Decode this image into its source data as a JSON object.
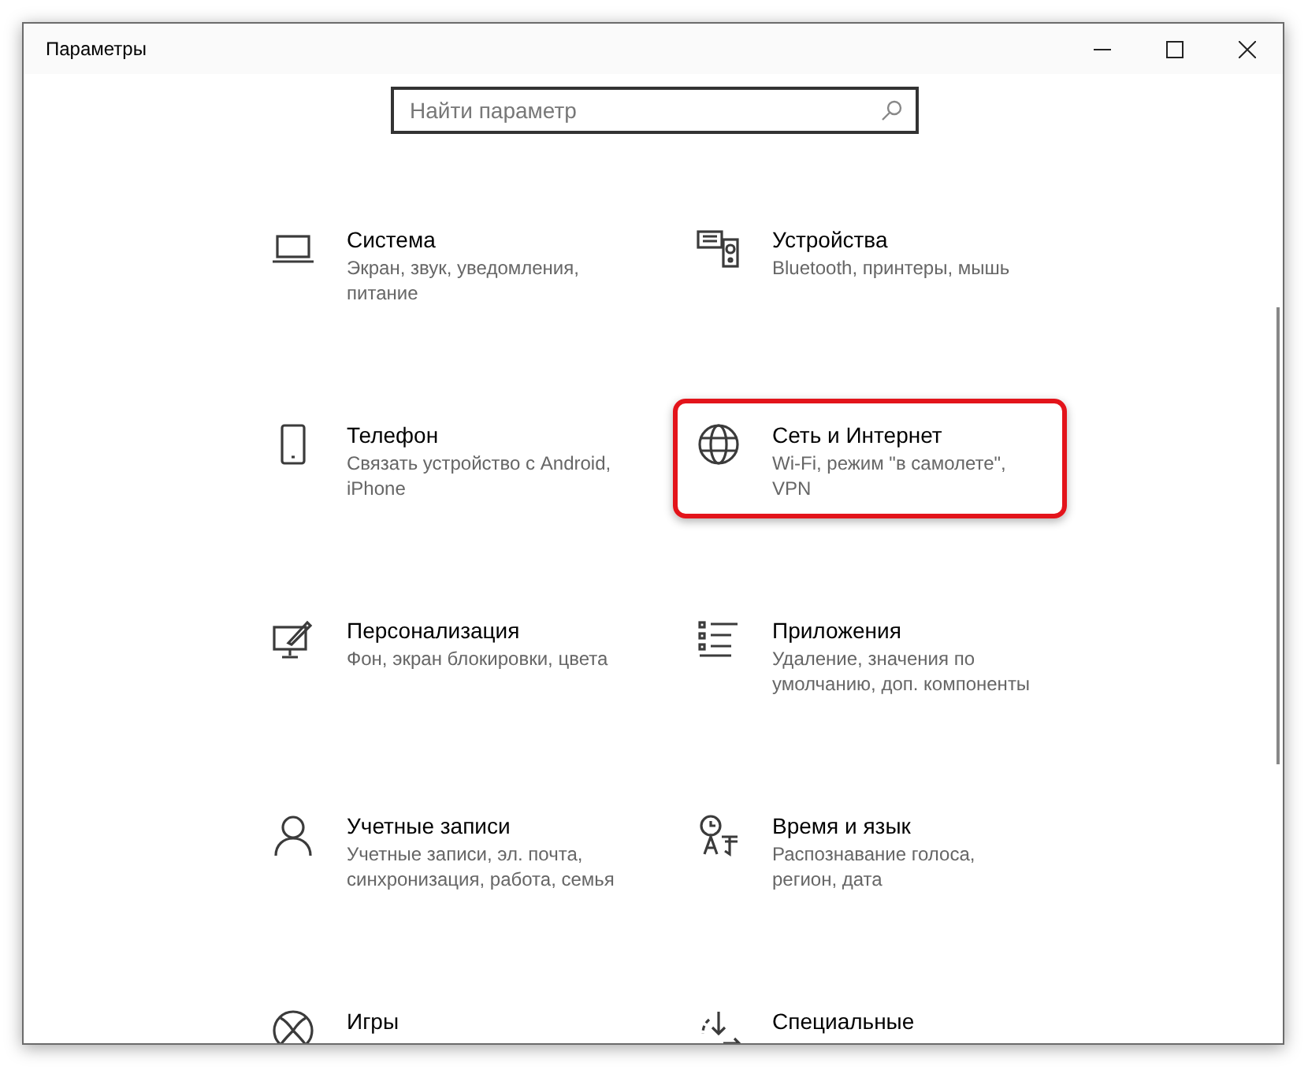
{
  "window": {
    "title": "Параметры"
  },
  "search": {
    "placeholder": "Найти параметр"
  },
  "categories": [
    {
      "title": "Система",
      "subtitle": "Экран, звук, уведомления, питание",
      "highlighted": false
    },
    {
      "title": "Устройства",
      "subtitle": "Bluetooth, принтеры, мышь",
      "highlighted": false
    },
    {
      "title": "Телефон",
      "subtitle": "Связать устройство с Android, iPhone",
      "highlighted": false
    },
    {
      "title": "Сеть и Интернет",
      "subtitle": "Wi-Fi, режим \"в самолете\", VPN",
      "highlighted": true
    },
    {
      "title": "Персонализация",
      "subtitle": "Фон, экран блокировки, цвета",
      "highlighted": false
    },
    {
      "title": "Приложения",
      "subtitle": "Удаление, значения по умолчанию, доп. компоненты",
      "highlighted": false
    },
    {
      "title": "Учетные записи",
      "subtitle": "Учетные записи, эл. почта, синхронизация, работа, семья",
      "highlighted": false
    },
    {
      "title": "Время и язык",
      "subtitle": "Распознавание голоса, регион, дата",
      "highlighted": false
    },
    {
      "title": "Игры",
      "highlighted": false
    },
    {
      "title": "Специальные",
      "highlighted": false
    }
  ]
}
